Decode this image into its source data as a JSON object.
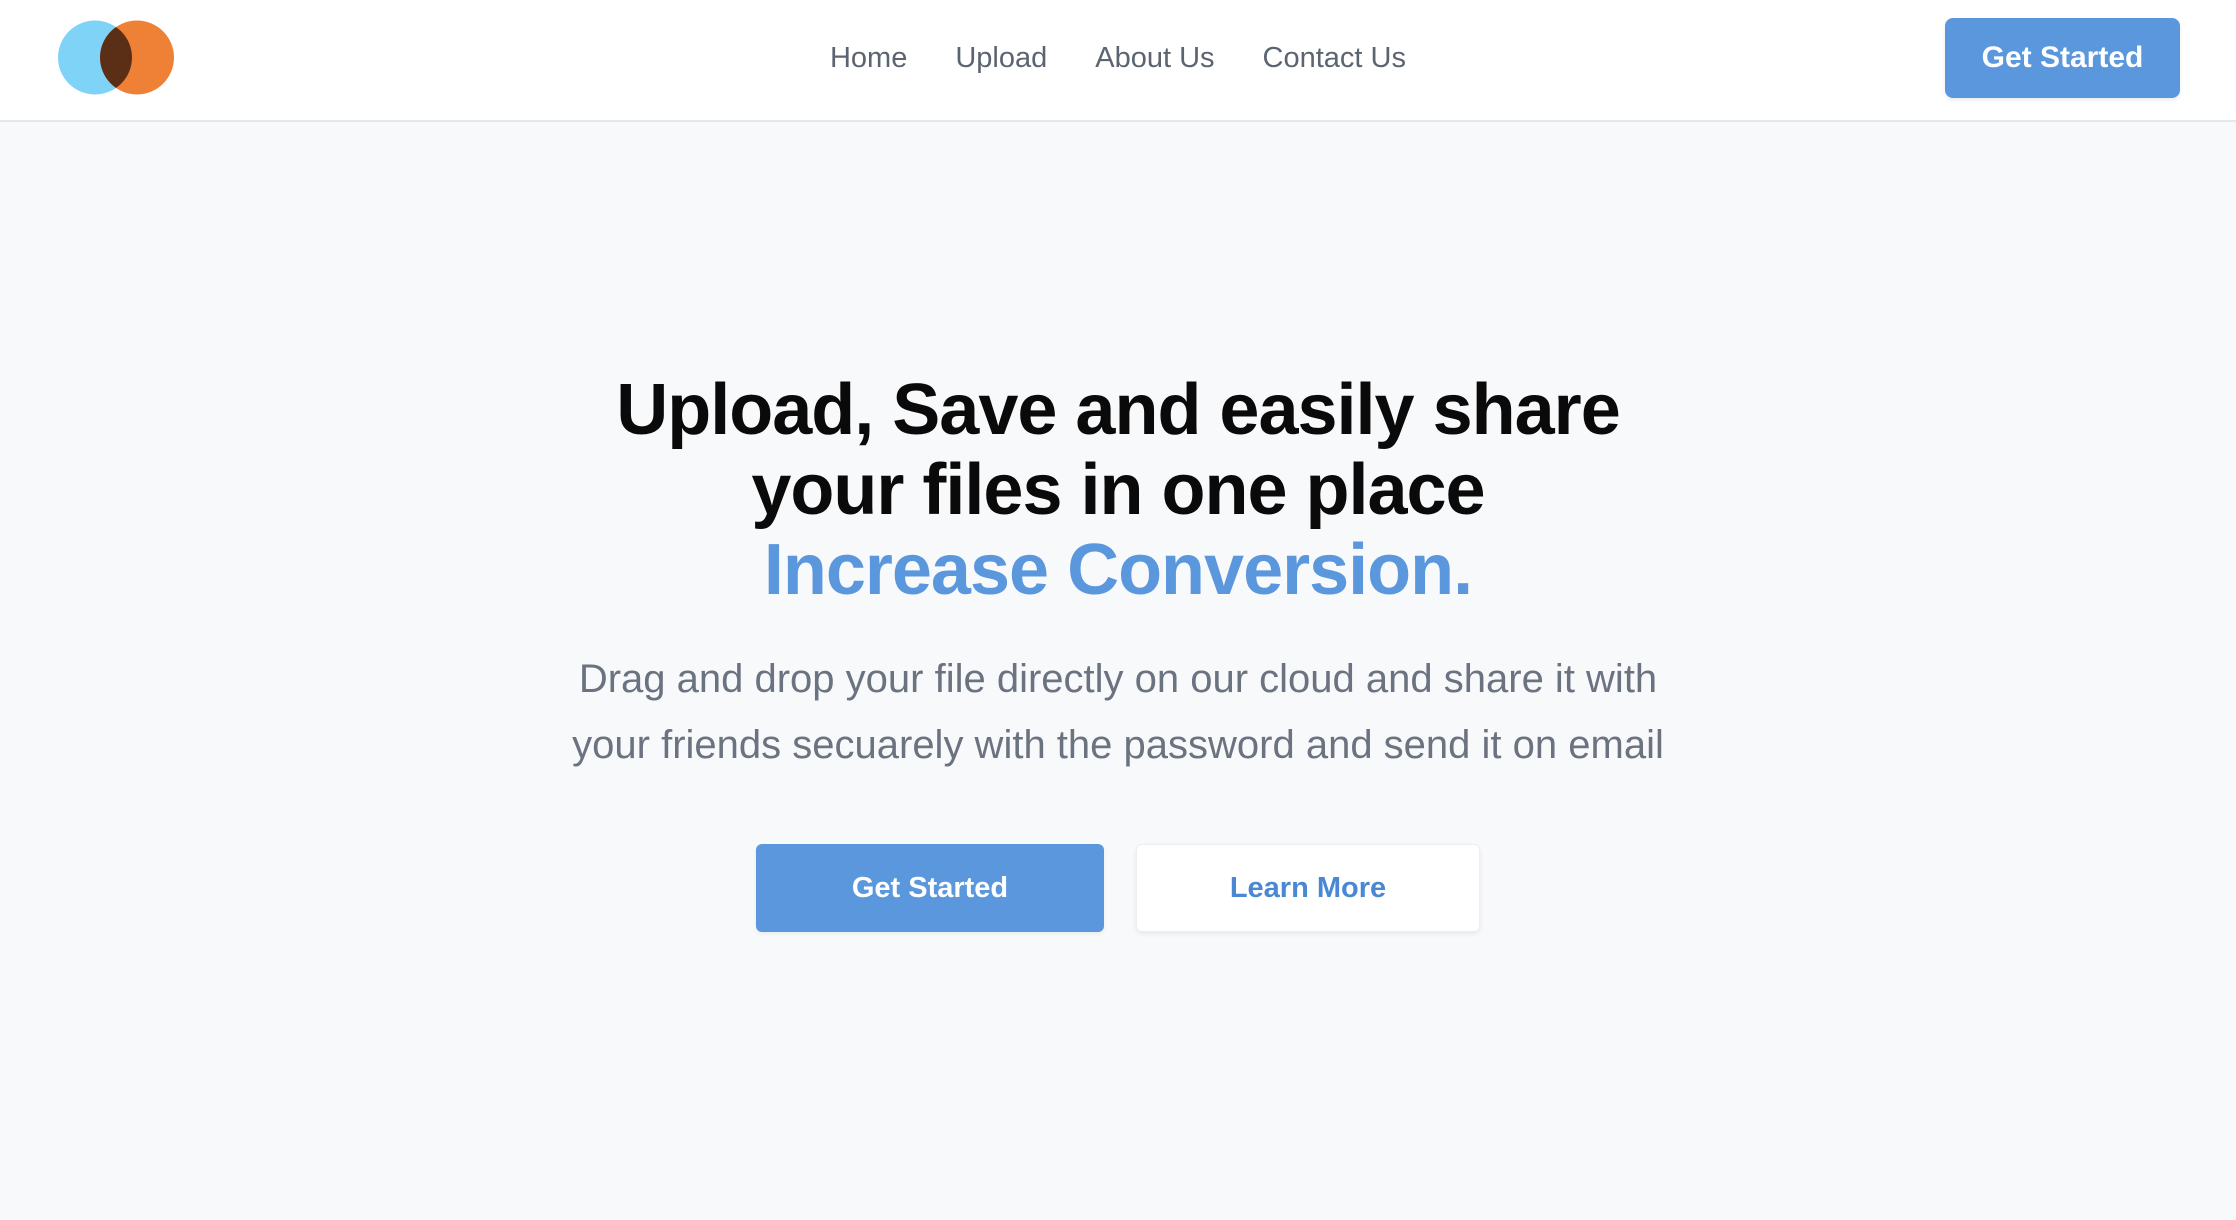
{
  "brand": {
    "logo_icon": "overlapping-circles-logo",
    "colors": {
      "left_circle": "#7fd3f7",
      "right_circle": "#ef8136",
      "overlap": "#5a2f16"
    }
  },
  "nav": {
    "items": [
      {
        "label": "Home"
      },
      {
        "label": "Upload"
      },
      {
        "label": "About Us"
      },
      {
        "label": "Contact Us"
      }
    ],
    "cta_label": "Get Started"
  },
  "hero": {
    "headline_line1": "Upload, Save and easily share your files in one place",
    "headline_accent": "Increase Conversion.",
    "subtitle": "Drag and drop your file directly on our cloud and share it with your friends secuarely with the password and send it on email",
    "primary_button": "Get Started",
    "secondary_button": "Learn More"
  },
  "theme": {
    "accent": "#5b97dc",
    "background": "#f8f9fb",
    "text_muted": "#6b7280"
  }
}
